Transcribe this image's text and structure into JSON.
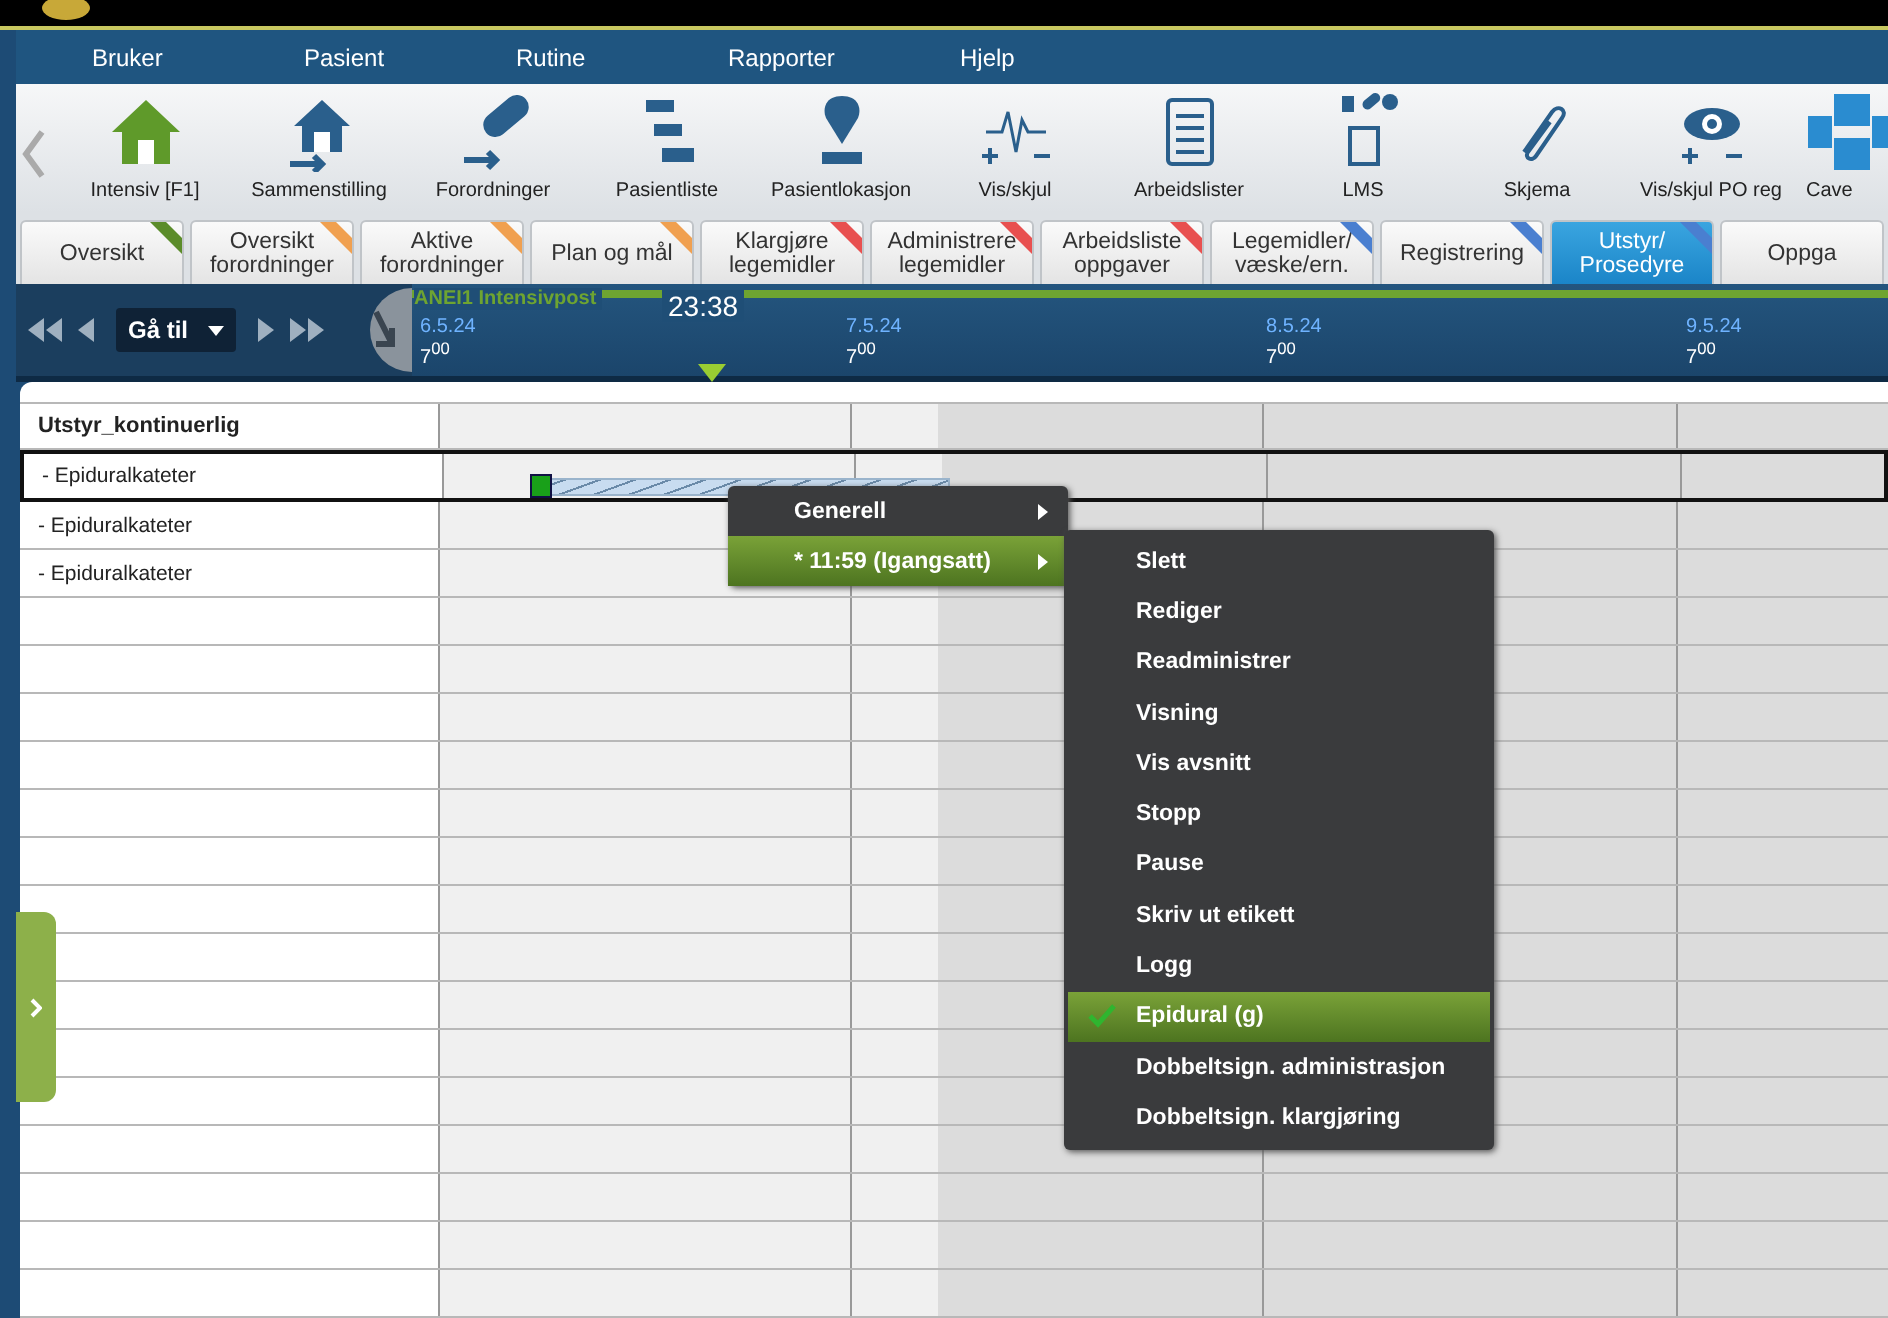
{
  "menu": [
    "Bruker",
    "Pasient",
    "Rutine",
    "Rapporter",
    "Hjelp"
  ],
  "toolbar": [
    {
      "label": "Intensiv [F1]"
    },
    {
      "label": "Sammenstilling"
    },
    {
      "label": "Forordninger"
    },
    {
      "label": "Pasientliste"
    },
    {
      "label": "Pasientlokasjon"
    },
    {
      "label": "Vis/skjul"
    },
    {
      "label": "Arbeidslister"
    },
    {
      "label": "LMS"
    },
    {
      "label": "Skjema"
    },
    {
      "label": "Vis/skjul PO reg"
    },
    {
      "label": "Cave"
    }
  ],
  "tabs": [
    {
      "label": "Oversikt",
      "color": "#5b8c2a",
      "selected": false
    },
    {
      "label": "Oversikt\nforordninger",
      "color": "#f0a050",
      "selected": false
    },
    {
      "label": "Aktive\nforordninger",
      "color": "#f0a050",
      "selected": false
    },
    {
      "label": "Plan og mål",
      "color": "#f0a050",
      "selected": false
    },
    {
      "label": "Klargjøre\nlegemidler",
      "color": "#e85050",
      "selected": false
    },
    {
      "label": "Administrere\nlegemidler",
      "color": "#e85050",
      "selected": false
    },
    {
      "label": "Arbeidsliste\noppgaver",
      "color": "#e85050",
      "selected": false
    },
    {
      "label": "Legemidler/\nvæske/ern.",
      "color": "#4a7fd0",
      "selected": false
    },
    {
      "label": "Registrering",
      "color": "#4a7fd0",
      "selected": false
    },
    {
      "label": "Utstyr/\nProsedyre",
      "color": "#4a7fd0",
      "selected": true
    },
    {
      "label": "Oppga",
      "selected": false
    }
  ],
  "timeline": {
    "goto": "Gå til",
    "unit": "ANEI1 Intensivpost",
    "time": "23:38",
    "days": [
      {
        "date": "6.5.24",
        "hour": "7$^{00}$"
      },
      {
        "date": "7.5.24",
        "hour": "7$^{00}$"
      },
      {
        "date": "8.5.24",
        "hour": "7$^{00}$"
      },
      {
        "date": "9.5.24",
        "hour": "7$^{00}$"
      }
    ]
  },
  "grid": {
    "header": "Utstyr_kontinuerlig",
    "rows": [
      {
        "label": "- Epiduralkateter",
        "selected": true,
        "bar": true
      },
      {
        "label": "- Epiduralkateter",
        "selected": false,
        "bar": false
      },
      {
        "label": "- Epiduralkateter",
        "selected": false,
        "bar": false
      }
    ]
  },
  "context_menu": {
    "items": [
      {
        "label": "Generell",
        "selected": false
      },
      {
        "label": "* 11:59 (Igangsatt)",
        "selected": true
      }
    ],
    "submenu": [
      {
        "label": "Slett",
        "checked": false
      },
      {
        "label": "Rediger",
        "checked": false
      },
      {
        "label": "Readministrer",
        "checked": false
      },
      {
        "label": "Visning",
        "checked": false
      },
      {
        "label": "Vis avsnitt",
        "checked": false
      },
      {
        "label": "Stopp",
        "checked": false
      },
      {
        "label": "Pause",
        "checked": false
      },
      {
        "label": "Skriv ut etikett",
        "checked": false
      },
      {
        "label": "Logg",
        "checked": false
      },
      {
        "label": "Epidural (g)",
        "checked": true
      },
      {
        "label": "Dobbeltsign. administrasjon",
        "checked": false
      },
      {
        "label": "Dobbeltsign. klargjøring",
        "checked": false
      }
    ]
  }
}
